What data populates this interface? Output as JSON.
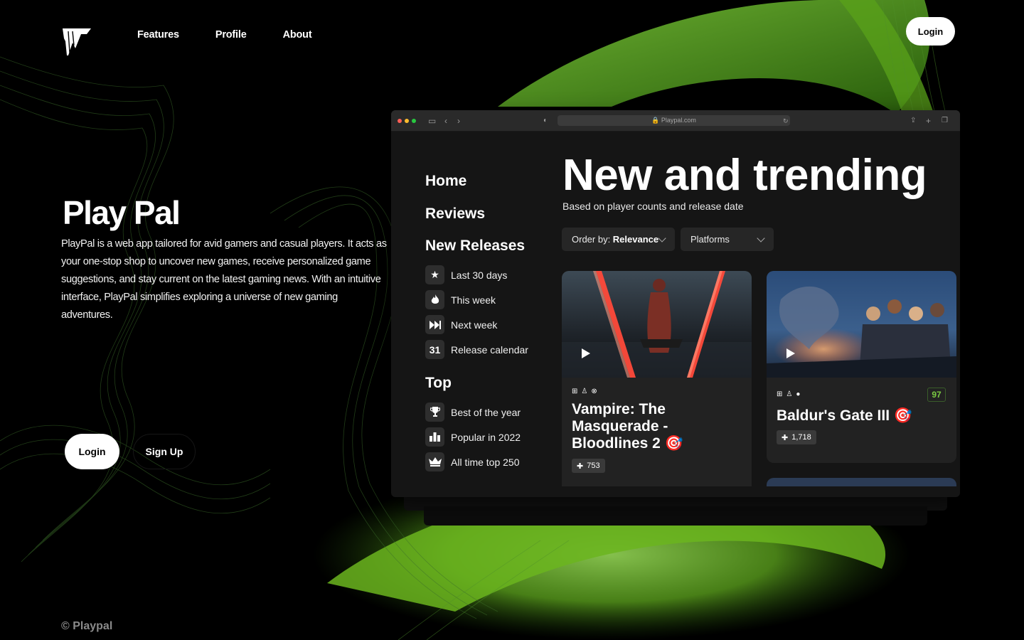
{
  "nav": {
    "items": [
      {
        "label": "Features"
      },
      {
        "label": "Profile"
      },
      {
        "label": "About"
      }
    ],
    "login_label": "Login"
  },
  "hero": {
    "title": "Play Pal",
    "description": "PlayPal is a web app tailored for avid gamers and casual players. It acts as your one-stop shop to uncover new games, receive personalized game suggestions, and stay current on the latest gaming news. With an intuitive interface, PlayPal simplifies exploring a universe of new gaming adventures.",
    "login_label": "Login",
    "signup_label": "Sign Up"
  },
  "footer": {
    "copyright": "© Playpal"
  },
  "browser": {
    "url": "Playpal.com",
    "sidebar": {
      "home": "Home",
      "reviews": "Reviews",
      "new_releases": "New Releases",
      "new_items": [
        {
          "label": "Last 30 days",
          "icon": "star-icon"
        },
        {
          "label": "This week",
          "icon": "flame-icon"
        },
        {
          "label": "Next week",
          "icon": "fast-forward-icon"
        },
        {
          "label": "Release calendar",
          "icon": "calendar-icon",
          "glyph": "31"
        }
      ],
      "top": "Top",
      "top_items": [
        {
          "label": "Best of the year",
          "icon": "trophy-icon"
        },
        {
          "label": "Popular in 2022",
          "icon": "bar-chart-icon"
        },
        {
          "label": "All time top 250",
          "icon": "crown-icon"
        }
      ]
    },
    "main": {
      "title": "New and trending",
      "subtitle": "Based on player counts and release date",
      "order_prefix": "Order by: ",
      "order_value": "Relevance",
      "platforms_label": "Platforms",
      "cards": [
        {
          "title": "Vampire: The Masquerade - Bloodlines 2 🎯",
          "platforms": [
            "windows-icon",
            "playstation-icon",
            "xbox-icon"
          ],
          "adds": "753"
        },
        {
          "title": "Baldur's Gate III 🎯",
          "platforms": [
            "windows-icon",
            "playstation-icon",
            "apple-icon"
          ],
          "adds": "1,718",
          "score": "97"
        }
      ]
    }
  },
  "colors": {
    "accent_green": "#7ac943",
    "glow_green": "#6fb323",
    "background": "#000000"
  }
}
